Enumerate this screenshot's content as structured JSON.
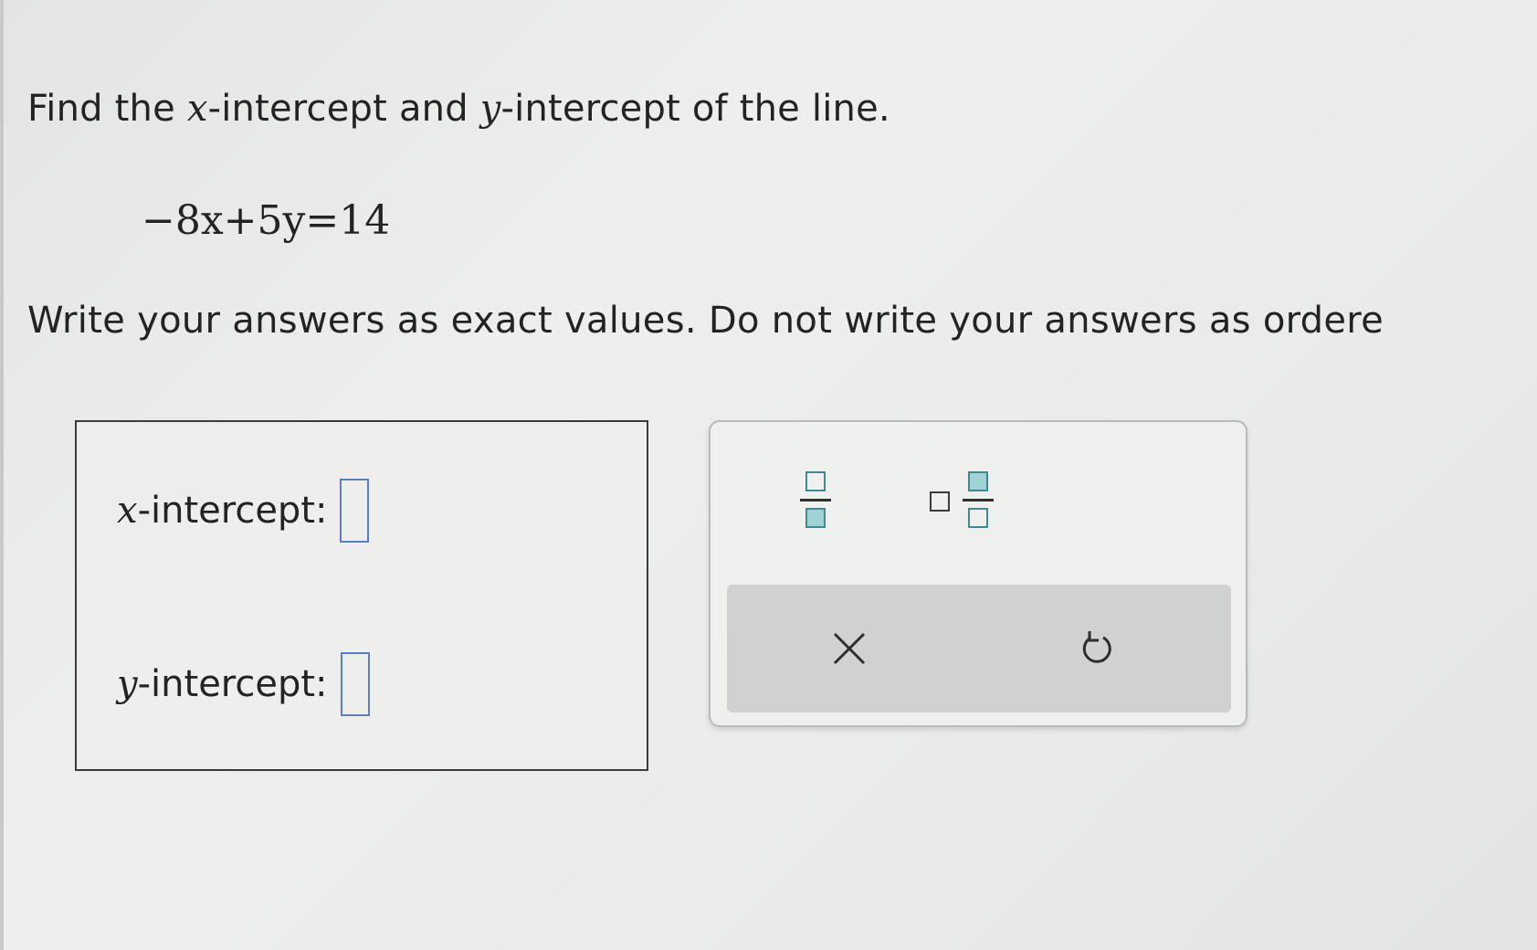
{
  "question": {
    "text_before": "Find the ",
    "var_x": "x",
    "text_middle": "-intercept and ",
    "var_y": "y",
    "text_after": "-intercept of the line."
  },
  "equation": "−8x+5y=14",
  "instruction": "Write your answers as exact values. Do not write your answers as ordere",
  "answers": {
    "x_var": "x",
    "x_label": "-intercept:",
    "x_value": "",
    "y_var": "y",
    "y_label": "-intercept:",
    "y_value": ""
  },
  "palette": {
    "buttons": [
      "fraction-icon",
      "mixed-number-icon"
    ],
    "actions": [
      "clear-icon",
      "undo-icon"
    ]
  },
  "colors": {
    "input_border": "#5a7fc0",
    "palette_teal": "#3f8a8f",
    "palette_fill": "#9fd3d6",
    "action_bar": "#cfd2d1"
  }
}
